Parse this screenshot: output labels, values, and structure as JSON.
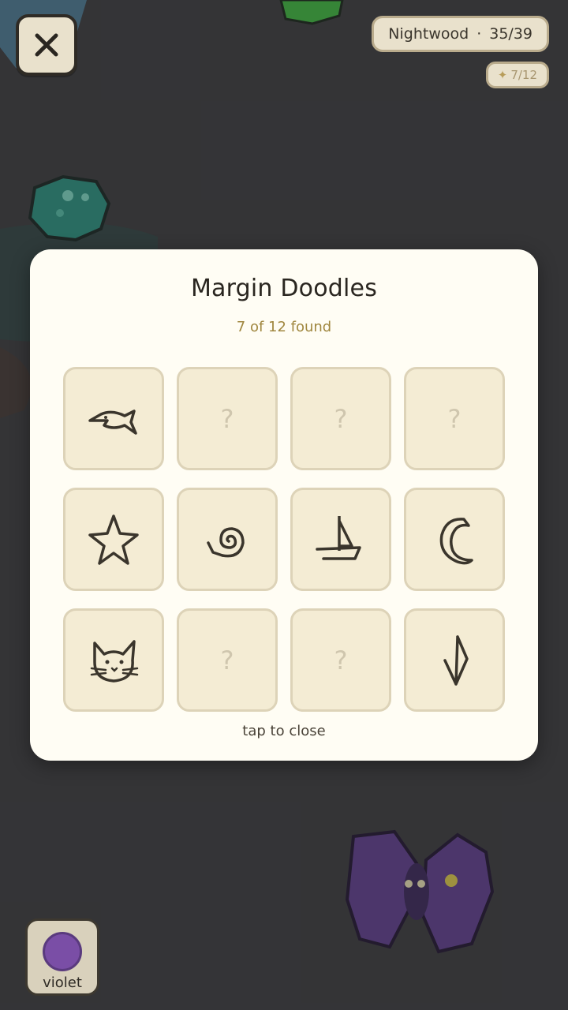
{
  "hud": {
    "level_name": "Nightwood",
    "separator": "·",
    "progress": "35/39",
    "doodle_count": "7/12",
    "spark_icon": "✦"
  },
  "modal": {
    "title": "Margin Doodles",
    "subtitle": "7 of 12 found",
    "close_hint": "tap to close",
    "tiles": [
      {
        "icon": "fish-doodle",
        "found": true,
        "text": ""
      },
      {
        "icon": "unknown",
        "found": false,
        "text": "?"
      },
      {
        "icon": "unknown",
        "found": false,
        "text": "?"
      },
      {
        "icon": "unknown",
        "found": false,
        "text": "?"
      },
      {
        "icon": "star-doodle",
        "found": true,
        "text": ""
      },
      {
        "icon": "snail-doodle",
        "found": true,
        "text": ""
      },
      {
        "icon": "sailboat-doodle",
        "found": true,
        "text": ""
      },
      {
        "icon": "moon-doodle",
        "found": true,
        "text": ""
      },
      {
        "icon": "cat-doodle",
        "found": true,
        "text": ""
      },
      {
        "icon": "unknown",
        "found": false,
        "text": "?"
      },
      {
        "icon": "unknown",
        "found": false,
        "text": "?"
      },
      {
        "icon": "kite-doodle",
        "found": true,
        "text": ""
      }
    ]
  },
  "color_picker": {
    "label": "violet",
    "color": "#7a4ea6"
  }
}
